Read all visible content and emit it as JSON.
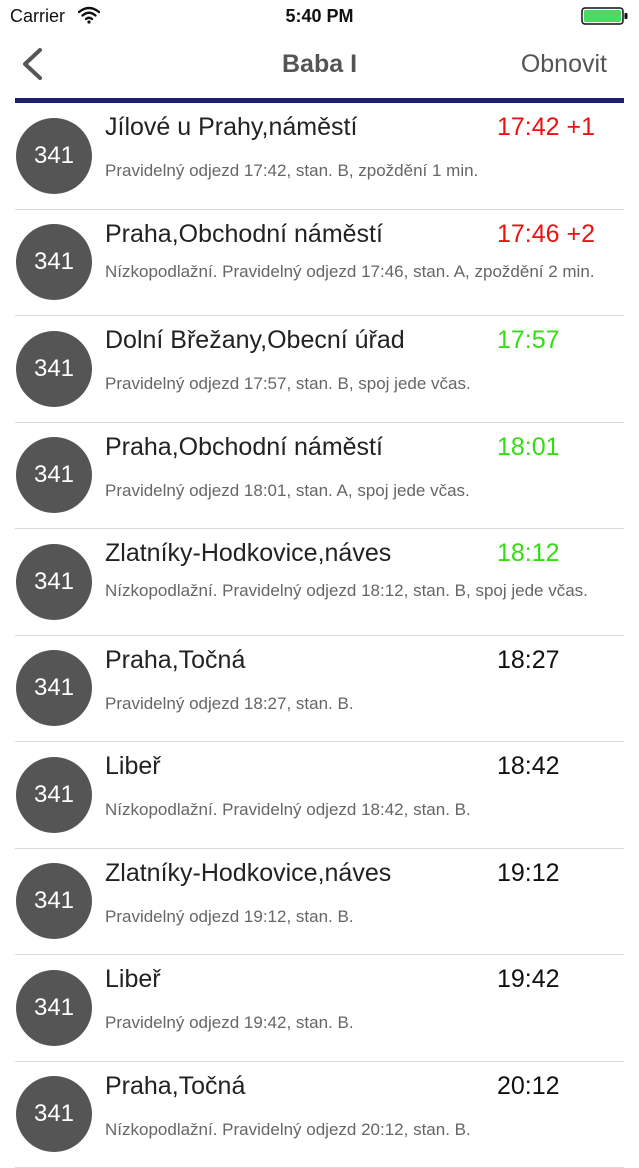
{
  "status_bar": {
    "carrier": "Carrier",
    "time": "5:40 PM",
    "wifi_icon": "wifi-icon",
    "battery_icon": "battery-icon",
    "battery_color": "#4cd964"
  },
  "nav": {
    "back_icon": "chevron-left-icon",
    "title": "Baba I",
    "refresh_label": "Obnovit",
    "divider_color": "#1e1e6e"
  },
  "colors": {
    "late": "#ee1111",
    "on_time": "#33dd11",
    "scheduled": "#111111",
    "badge": "#555555"
  },
  "departures": [
    {
      "line": "341",
      "destination": "Jílové u Prahy,náměstí",
      "time": "17:42 +1",
      "status": "late",
      "info": "Pravidelný odjezd 17:42, stan. B, zpoždění 1 min."
    },
    {
      "line": "341",
      "destination": "Praha,Obchodní náměstí",
      "time": "17:46 +2",
      "status": "late",
      "info": "Nízkopodlažní. Pravidelný odjezd 17:46, stan. A, zpoždění 2 min."
    },
    {
      "line": "341",
      "destination": "Dolní Břežany,Obecní úřad",
      "time": "17:57",
      "status": "on_time",
      "info": "Pravidelný odjezd 17:57, stan. B, spoj jede včas."
    },
    {
      "line": "341",
      "destination": "Praha,Obchodní náměstí",
      "time": "18:01",
      "status": "on_time",
      "info": "Pravidelný odjezd 18:01, stan. A, spoj jede včas."
    },
    {
      "line": "341",
      "destination": "Zlatníky-Hodkovice,náves",
      "time": "18:12",
      "status": "on_time",
      "info": "Nízkopodlažní. Pravidelný odjezd 18:12, stan. B, spoj jede včas."
    },
    {
      "line": "341",
      "destination": "Praha,Točná",
      "time": "18:27",
      "status": "scheduled",
      "info": "Pravidelný odjezd 18:27, stan. B."
    },
    {
      "line": "341",
      "destination": "Libeř",
      "time": "18:42",
      "status": "scheduled",
      "info": "Nízkopodlažní. Pravidelný odjezd 18:42, stan. B."
    },
    {
      "line": "341",
      "destination": "Zlatníky-Hodkovice,náves",
      "time": "19:12",
      "status": "scheduled",
      "info": "Pravidelný odjezd 19:12, stan. B."
    },
    {
      "line": "341",
      "destination": "Libeř",
      "time": "19:42",
      "status": "scheduled",
      "info": "Pravidelný odjezd 19:42, stan. B."
    },
    {
      "line": "341",
      "destination": "Praha,Točná",
      "time": "20:12",
      "status": "scheduled",
      "info": "Nízkopodlažní. Pravidelný odjezd 20:12, stan. B."
    }
  ]
}
